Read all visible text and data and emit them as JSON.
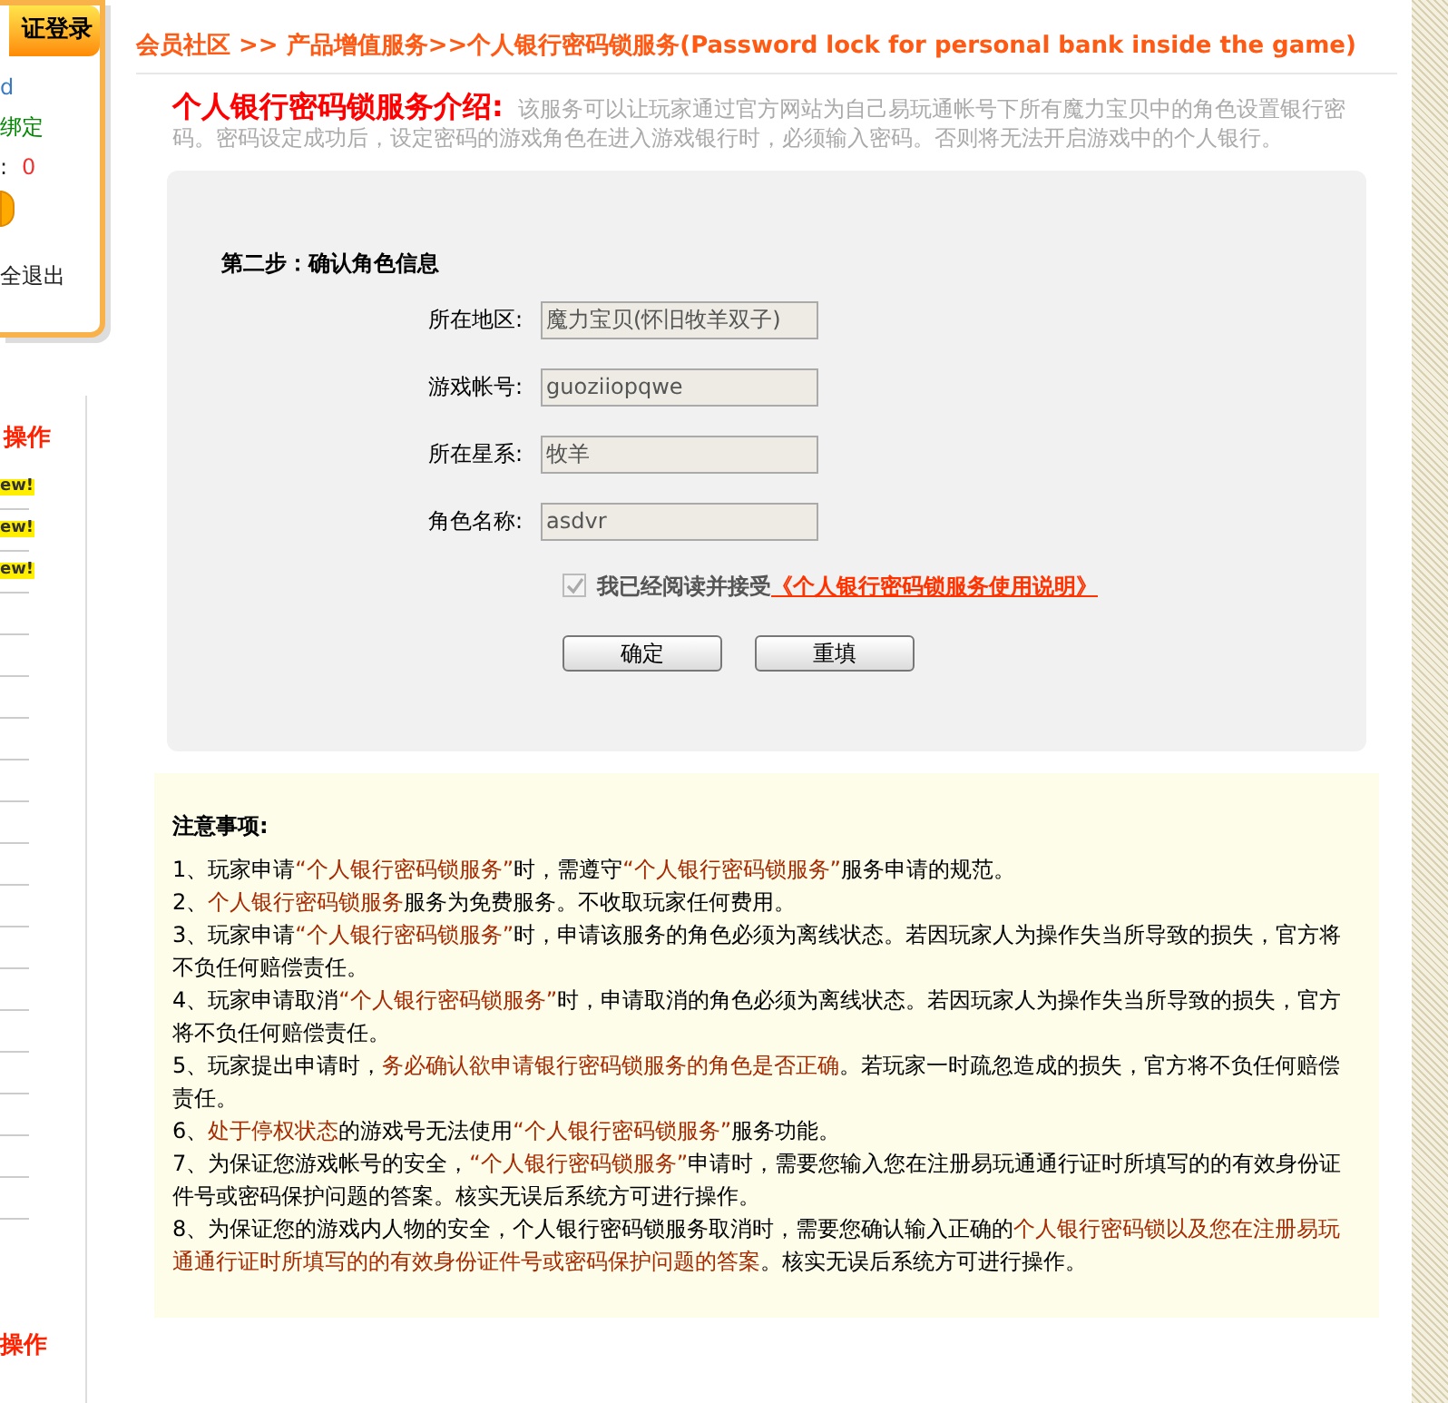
{
  "sidebar": {
    "login_button": "证登录",
    "account_fragment": "d",
    "bind_fragment": "绑定",
    "points_label": ":",
    "points_value": "0",
    "logout": "全退出",
    "section_title": "操作",
    "badges": [
      "ew!",
      "ew!",
      "ew!"
    ],
    "bottom_title": "操作"
  },
  "breadcrumb": "会员社区 >> 产品增值服务>>个人银行密码锁服务(Password lock for personal bank inside the game)",
  "intro": {
    "title": "个人银行密码锁服务介绍:",
    "text": "该服务可以让玩家通过官方网站为自己易玩通帐号下所有魔力宝贝中的角色设置银行密码。密码设定成功后，设定密码的游戏角色在进入游戏银行时，必须输入密码。否则将无法开启游戏中的个人银行。"
  },
  "form": {
    "step_title": "第二步：确认角色信息",
    "fields": [
      {
        "label": "所在地区:",
        "value": "魔力宝贝(怀旧牧羊双子)"
      },
      {
        "label": "游戏帐号:",
        "value": "guoziiopqwe"
      },
      {
        "label": "所在星系:",
        "value": "牧羊"
      },
      {
        "label": "角色名称:",
        "value": "asdvr"
      }
    ],
    "agreement": {
      "checked": true,
      "disabled": true,
      "text": "我已经阅读并接受",
      "link": "《个人银行密码锁服务使用说明》"
    },
    "buttons": [
      "确定",
      "重填"
    ]
  },
  "notes": {
    "title": "注意事项:",
    "items": [
      [
        {
          "text": "1、玩家申请",
          "highlight": false
        },
        {
          "text": "“个人银行密码锁服务”",
          "highlight": true
        },
        {
          "text": "时，需遵守",
          "highlight": false
        },
        {
          "text": "“个人银行密码锁服务”",
          "highlight": true
        },
        {
          "text": "服务申请的规范。",
          "highlight": false
        }
      ],
      [
        {
          "text": "2、",
          "highlight": false
        },
        {
          "text": "个人银行密码锁服务",
          "highlight": true
        },
        {
          "text": "服务为免费服务。不收取玩家任何费用。",
          "highlight": false
        }
      ],
      [
        {
          "text": "3、玩家申请",
          "highlight": false
        },
        {
          "text": "“个人银行密码锁服务”",
          "highlight": true
        },
        {
          "text": "时，申请该服务的角色必须为离线状态。若因玩家人为操作失当所导致的损失，官方将不负任何赔偿责任。",
          "highlight": false
        }
      ],
      [
        {
          "text": "4、玩家申请取消",
          "highlight": false
        },
        {
          "text": "“个人银行密码锁服务”",
          "highlight": true
        },
        {
          "text": "时，申请取消的角色必须为离线状态。若因玩家人为操作失当所导致的损失，官方将不负任何赔偿责任。",
          "highlight": false
        }
      ],
      [
        {
          "text": "5、玩家提出申请时，",
          "highlight": false
        },
        {
          "text": "务必确认欲申请银行密码锁服务的角色是否正确",
          "highlight": true
        },
        {
          "text": "。若玩家一时疏忽造成的损失，官方将不负任何赔偿责任。",
          "highlight": false
        }
      ],
      [
        {
          "text": "6、",
          "highlight": false
        },
        {
          "text": "处于停权状态",
          "highlight": true
        },
        {
          "text": "的游戏号无法使用",
          "highlight": false
        },
        {
          "text": "“个人银行密码锁服务”",
          "highlight": true
        },
        {
          "text": "服务功能。",
          "highlight": false
        }
      ],
      [
        {
          "text": "7、为保证您游戏帐号的安全，",
          "highlight": false
        },
        {
          "text": "“个人银行密码锁服务”",
          "highlight": true
        },
        {
          "text": "申请时，需要您输入您在注册易玩通通行证时所填写的的有效身份证件号或密码保护问题的答案。核实无误后系统方可进行操作。",
          "highlight": false
        }
      ],
      [
        {
          "text": "8、为保证您的游戏内人物的安全，个人银行密码锁服务取消时，需要您确认输入正确的",
          "highlight": false
        },
        {
          "text": "个人银行密码锁以及您在注册易玩通通行证时所填写的的有效身份证件号或密码保护问题的答案",
          "highlight": true
        },
        {
          "text": "。核实无误后系统方可进行操作。",
          "highlight": false
        }
      ]
    ]
  }
}
